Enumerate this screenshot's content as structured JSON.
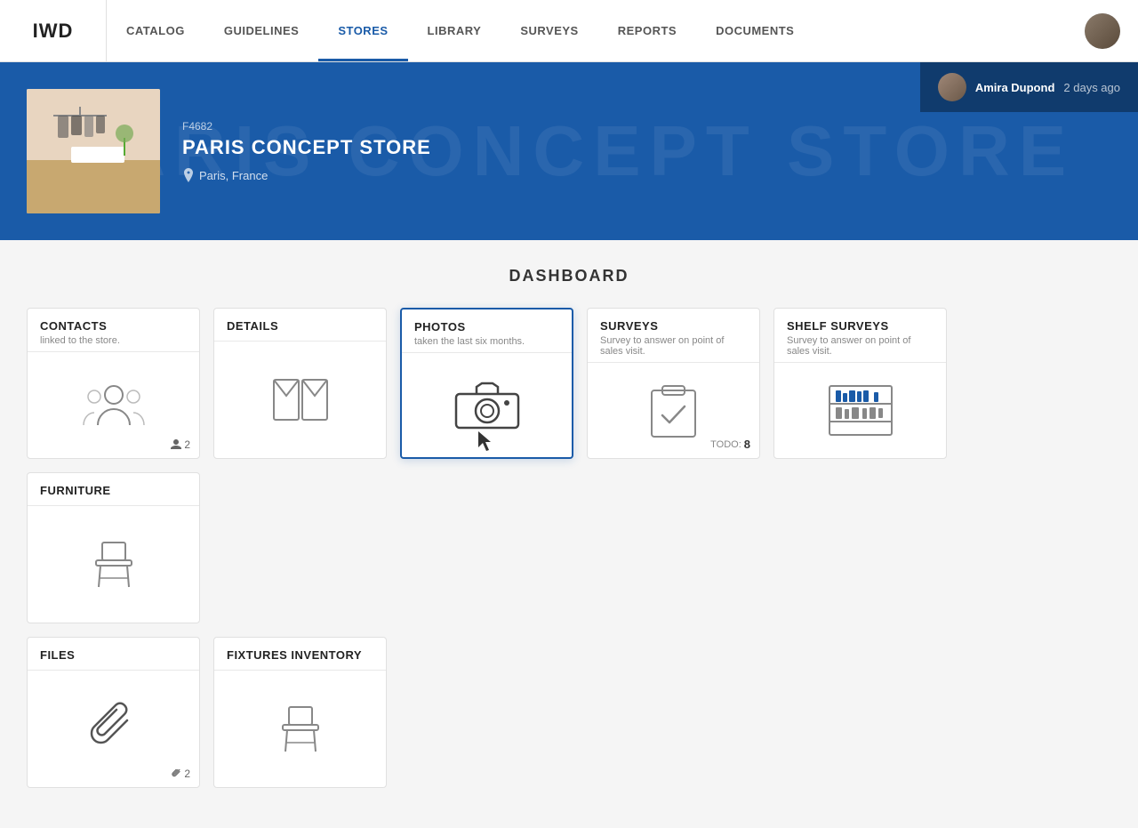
{
  "logo": {
    "text": "IWD"
  },
  "nav": {
    "items": [
      {
        "label": "CATALOG",
        "active": false
      },
      {
        "label": "GUIDELINES",
        "active": false
      },
      {
        "label": "STORES",
        "active": true
      },
      {
        "label": "LIBRARY",
        "active": false
      },
      {
        "label": "SURVEYS",
        "active": false
      },
      {
        "label": "REPORTS",
        "active": false
      },
      {
        "label": "DOCUMENTS",
        "active": false
      }
    ]
  },
  "hero": {
    "bg_text": "PARIS CONCEPT STORE",
    "store_code": "F4682",
    "store_name": "PARIS CONCEPT STORE",
    "location": "Paris, France",
    "user": {
      "name": "Amira Dupond",
      "time": "2 days ago"
    }
  },
  "dashboard": {
    "title": "DASHBOARD",
    "cards": [
      {
        "id": "contacts",
        "title": "CONTACTS",
        "subtitle": "linked to the store.",
        "badge_count": "2",
        "badge_icon": "person",
        "active": false
      },
      {
        "id": "details",
        "title": "DETAILS",
        "subtitle": "",
        "badge_count": "",
        "active": false
      },
      {
        "id": "photos",
        "title": "PHOTOS",
        "subtitle": "taken the last six months.",
        "badge_count": "",
        "active": true
      },
      {
        "id": "surveys",
        "title": "SURVEYS",
        "subtitle": "Survey to answer on point of sales visit.",
        "todo_label": "TODO:",
        "todo_count": "8",
        "active": false
      },
      {
        "id": "shelf-surveys",
        "title": "SHELF SURVEYS",
        "subtitle": "Survey to answer on point of sales visit.",
        "badge_count": "",
        "active": false
      },
      {
        "id": "furniture",
        "title": "FURNITURE",
        "subtitle": "",
        "badge_count": "",
        "active": false
      }
    ],
    "cards2": [
      {
        "id": "files",
        "title": "FILES",
        "subtitle": "",
        "badge_count": "2",
        "badge_icon": "paperclip",
        "active": false
      },
      {
        "id": "fixtures-inventory",
        "title": "FIXTURES INVENTORY",
        "subtitle": "",
        "badge_count": "",
        "active": false
      }
    ]
  }
}
